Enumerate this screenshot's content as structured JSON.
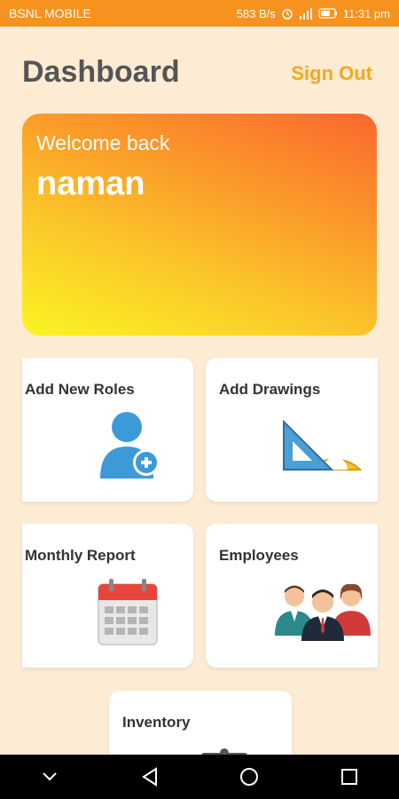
{
  "status_bar": {
    "carrier": "BSNL MOBILE",
    "net_speed": "583 B/s",
    "time": "11:31 pm"
  },
  "header": {
    "title": "Dashboard",
    "sign_out_label": "Sign Out"
  },
  "welcome": {
    "greeting": "Welcome back",
    "user_name": "naman"
  },
  "tiles": [
    {
      "label": "Add New Roles",
      "icon": "add-user-icon"
    },
    {
      "label": "Add Drawings",
      "icon": "drawing-tools-icon"
    },
    {
      "label": "Monthly Report",
      "icon": "calendar-icon"
    },
    {
      "label": "Employees",
      "icon": "employees-icon"
    },
    {
      "label": "Inventory",
      "icon": "inventory-icon"
    }
  ],
  "colors": {
    "status_bar": "#f8921e",
    "background": "#fdebd3",
    "accent": "#f2a91c"
  }
}
